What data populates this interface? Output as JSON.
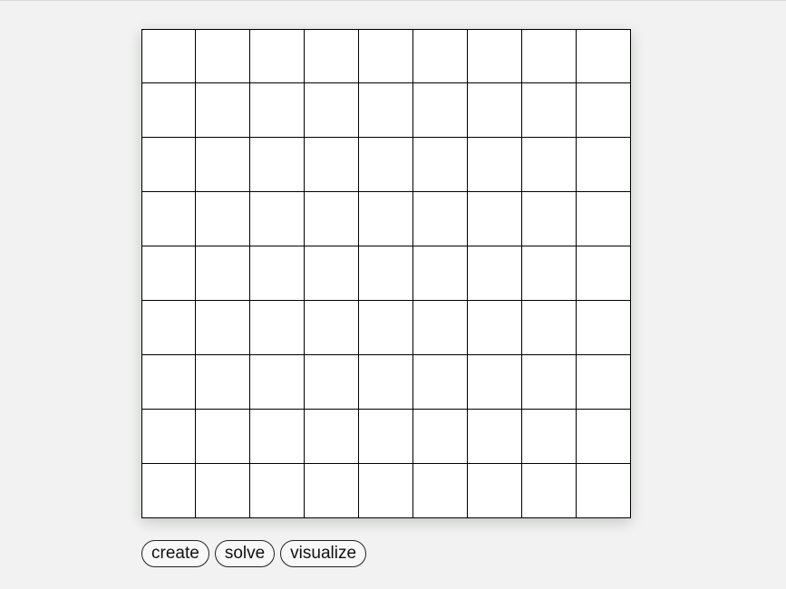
{
  "board": {
    "rows": 9,
    "cols": 9,
    "cells": [
      [
        "",
        "",
        "",
        "",
        "",
        "",
        "",
        "",
        ""
      ],
      [
        "",
        "",
        "",
        "",
        "",
        "",
        "",
        "",
        ""
      ],
      [
        "",
        "",
        "",
        "",
        "",
        "",
        "",
        "",
        ""
      ],
      [
        "",
        "",
        "",
        "",
        "",
        "",
        "",
        "",
        ""
      ],
      [
        "",
        "",
        "",
        "",
        "",
        "",
        "",
        "",
        ""
      ],
      [
        "",
        "",
        "",
        "",
        "",
        "",
        "",
        "",
        ""
      ],
      [
        "",
        "",
        "",
        "",
        "",
        "",
        "",
        "",
        ""
      ],
      [
        "",
        "",
        "",
        "",
        "",
        "",
        "",
        "",
        ""
      ],
      [
        "",
        "",
        "",
        "",
        "",
        "",
        "",
        "",
        ""
      ]
    ]
  },
  "controls": {
    "create_label": "create",
    "solve_label": "solve",
    "visualize_label": "visualize"
  }
}
